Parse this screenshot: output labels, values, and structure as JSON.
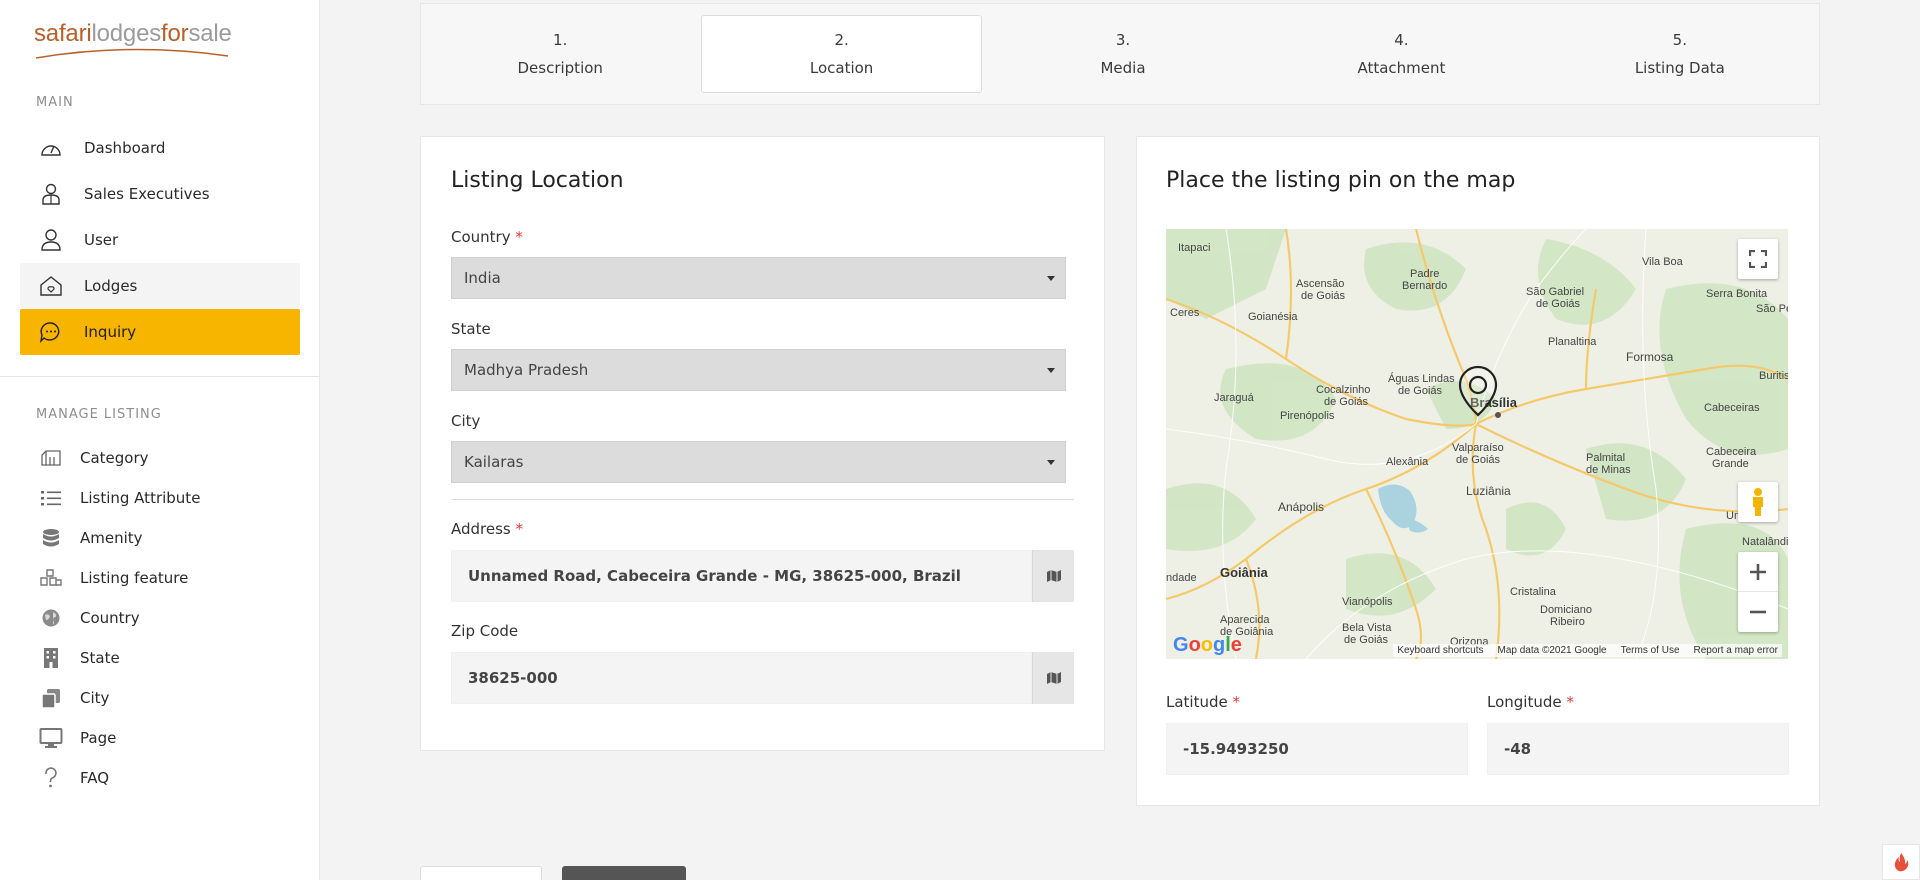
{
  "brand": {
    "part1": "safari",
    "part2": "lodges",
    "part3": "for",
    "part4": "sale"
  },
  "sidebar": {
    "main_label": "MAIN",
    "main_items": [
      {
        "label": "Dashboard",
        "icon": "speedometer-icon"
      },
      {
        "label": "Sales Executives",
        "icon": "sales-executive-icon"
      },
      {
        "label": "User",
        "icon": "user-icon"
      },
      {
        "label": "Lodges",
        "icon": "lodge-house-icon"
      },
      {
        "label": "Inquiry",
        "icon": "chat-bubble-icon"
      }
    ],
    "manage_label": "MANAGE LISTING",
    "manage_items": [
      {
        "label": "Category",
        "icon": "category-icon"
      },
      {
        "label": "Listing Attribute",
        "icon": "list-icon"
      },
      {
        "label": "Amenity",
        "icon": "database-icon"
      },
      {
        "label": "Listing feature",
        "icon": "cubes-icon"
      },
      {
        "label": "Country",
        "icon": "globe-icon"
      },
      {
        "label": "State",
        "icon": "building-icon"
      },
      {
        "label": "City",
        "icon": "copy-icon"
      },
      {
        "label": "Page",
        "icon": "monitor-icon"
      },
      {
        "label": "FAQ",
        "icon": "question-icon"
      }
    ],
    "active_color": "#f7b500"
  },
  "steps": [
    {
      "num": "1.",
      "label": "Description"
    },
    {
      "num": "2.",
      "label": "Location"
    },
    {
      "num": "3.",
      "label": "Media"
    },
    {
      "num": "4.",
      "label": "Attachment"
    },
    {
      "num": "5.",
      "label": "Listing Data"
    }
  ],
  "location": {
    "title": "Listing Location",
    "country_label": "Country",
    "country_value": "India",
    "state_label": "State",
    "state_value": "Madhya Pradesh",
    "city_label": "City",
    "city_value": "Kailaras",
    "address_label": "Address",
    "address_value": "Unnamed Road, Cabeceira Grande - MG, 38625-000, Brazil",
    "zip_label": "Zip Code",
    "zip_value": "38625-000",
    "required_mark": "*"
  },
  "map": {
    "title": "Place the listing pin on the map",
    "places": [
      "Itapaci",
      "Ascensão",
      "Padre Bernardo",
      "São Gabriel de Goiás",
      "Vila Boa",
      "Serra Bonita",
      "São Ped",
      "Ceres",
      "Goianésia",
      "Planaltina",
      "Formosa",
      "Buritis",
      "Águas Lindas de Goiás",
      "Brasília",
      "Jaraguá",
      "Cocalzinho de Goiás",
      "Pirenópolis",
      "Cabeceiras",
      "Valparaíso de Goiás",
      "Alexânia",
      "Palmital de Minas",
      "Cabeceira Grande",
      "Anápolis",
      "Luziânia",
      "Unaí",
      "Natalândia",
      "ndade",
      "Goiânia",
      "Vianópolis",
      "Cristalina",
      "Domiciano Ribeiro",
      "Aparecida de Goiânia",
      "Bela Vista de Goiás",
      "Orizona"
    ],
    "footer": [
      "Keyboard shortcuts",
      "Map data ©2021 Google",
      "Terms of Use",
      "Report a map error"
    ],
    "google_logo": "Google",
    "latitude_label": "Latitude",
    "latitude_value": "-15.9493250",
    "longitude_label": "Longitude",
    "longitude_value": "-48"
  }
}
